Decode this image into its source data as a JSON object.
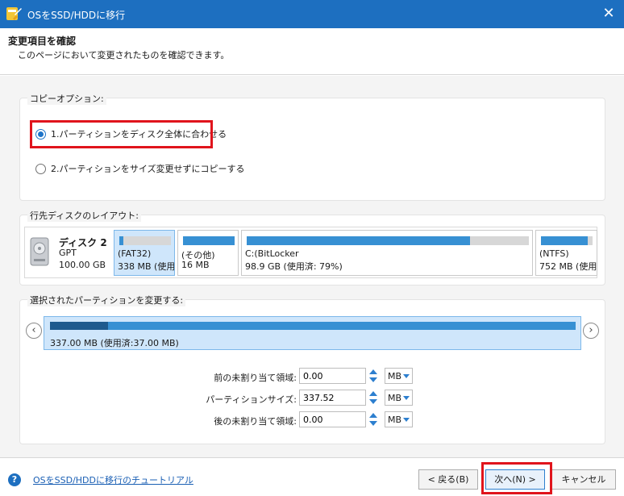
{
  "window": {
    "title": "OSをSSD/HDDに移行",
    "close_label": "✕"
  },
  "header": {
    "title": "変更項目を確認",
    "subtitle": "このページにおいて変更されたものを確認できます。"
  },
  "copy_options": {
    "label": "コピーオプション:",
    "options": [
      {
        "label": "1.パーティションをディスク全体に合わせる",
        "selected": true
      },
      {
        "label": "2.パーティションをサイズ変更せずにコピーする",
        "selected": false
      }
    ]
  },
  "target_layout": {
    "label": "行先ディスクのレイアウト:",
    "disk": {
      "name": "ディスク 2",
      "type": "GPT",
      "size": "100.00 GB"
    },
    "partitions": [
      {
        "line1": "(FAT32)",
        "line2": "338 MB (使用",
        "used": 0.08,
        "selected": true
      },
      {
        "line1": "(その他)",
        "line2": "16 MB",
        "used": 1.0,
        "selected": false
      },
      {
        "line1": "C:(BitLocker",
        "line2": "98.9 GB (使用済: 79%)",
        "used": 0.79,
        "selected": false
      },
      {
        "line1": "(NTFS)",
        "line2": "752 MB (使用",
        "used": 0.9,
        "selected": false
      }
    ]
  },
  "change_partition": {
    "label": "選択されたパーティションを変更する:",
    "selected_partition_text": "337.00 MB (使用済:37.00 MB)",
    "used": 0.11,
    "fields": [
      {
        "label": "前の未割り当て領域:",
        "value": "0.00",
        "unit": "MB"
      },
      {
        "label": "パーティションサイズ:",
        "value": "337.52",
        "unit": "MB"
      },
      {
        "label": "後の未割り当て領域:",
        "value": "0.00",
        "unit": "MB"
      }
    ]
  },
  "footer": {
    "help_symbol": "?",
    "tutorial_link": "OSをSSD/HDDに移行のチュートリアル",
    "back_label": "< 戻る(B)",
    "next_label": "次へ(N) >",
    "cancel_label": "キャンセル"
  },
  "colors": {
    "titlebar": "#1d6fc0",
    "accent": "#1e74c8",
    "highlight": "#e0141c",
    "selected_bg": "#cfe6fb",
    "bar_fill": "#3790d3"
  }
}
